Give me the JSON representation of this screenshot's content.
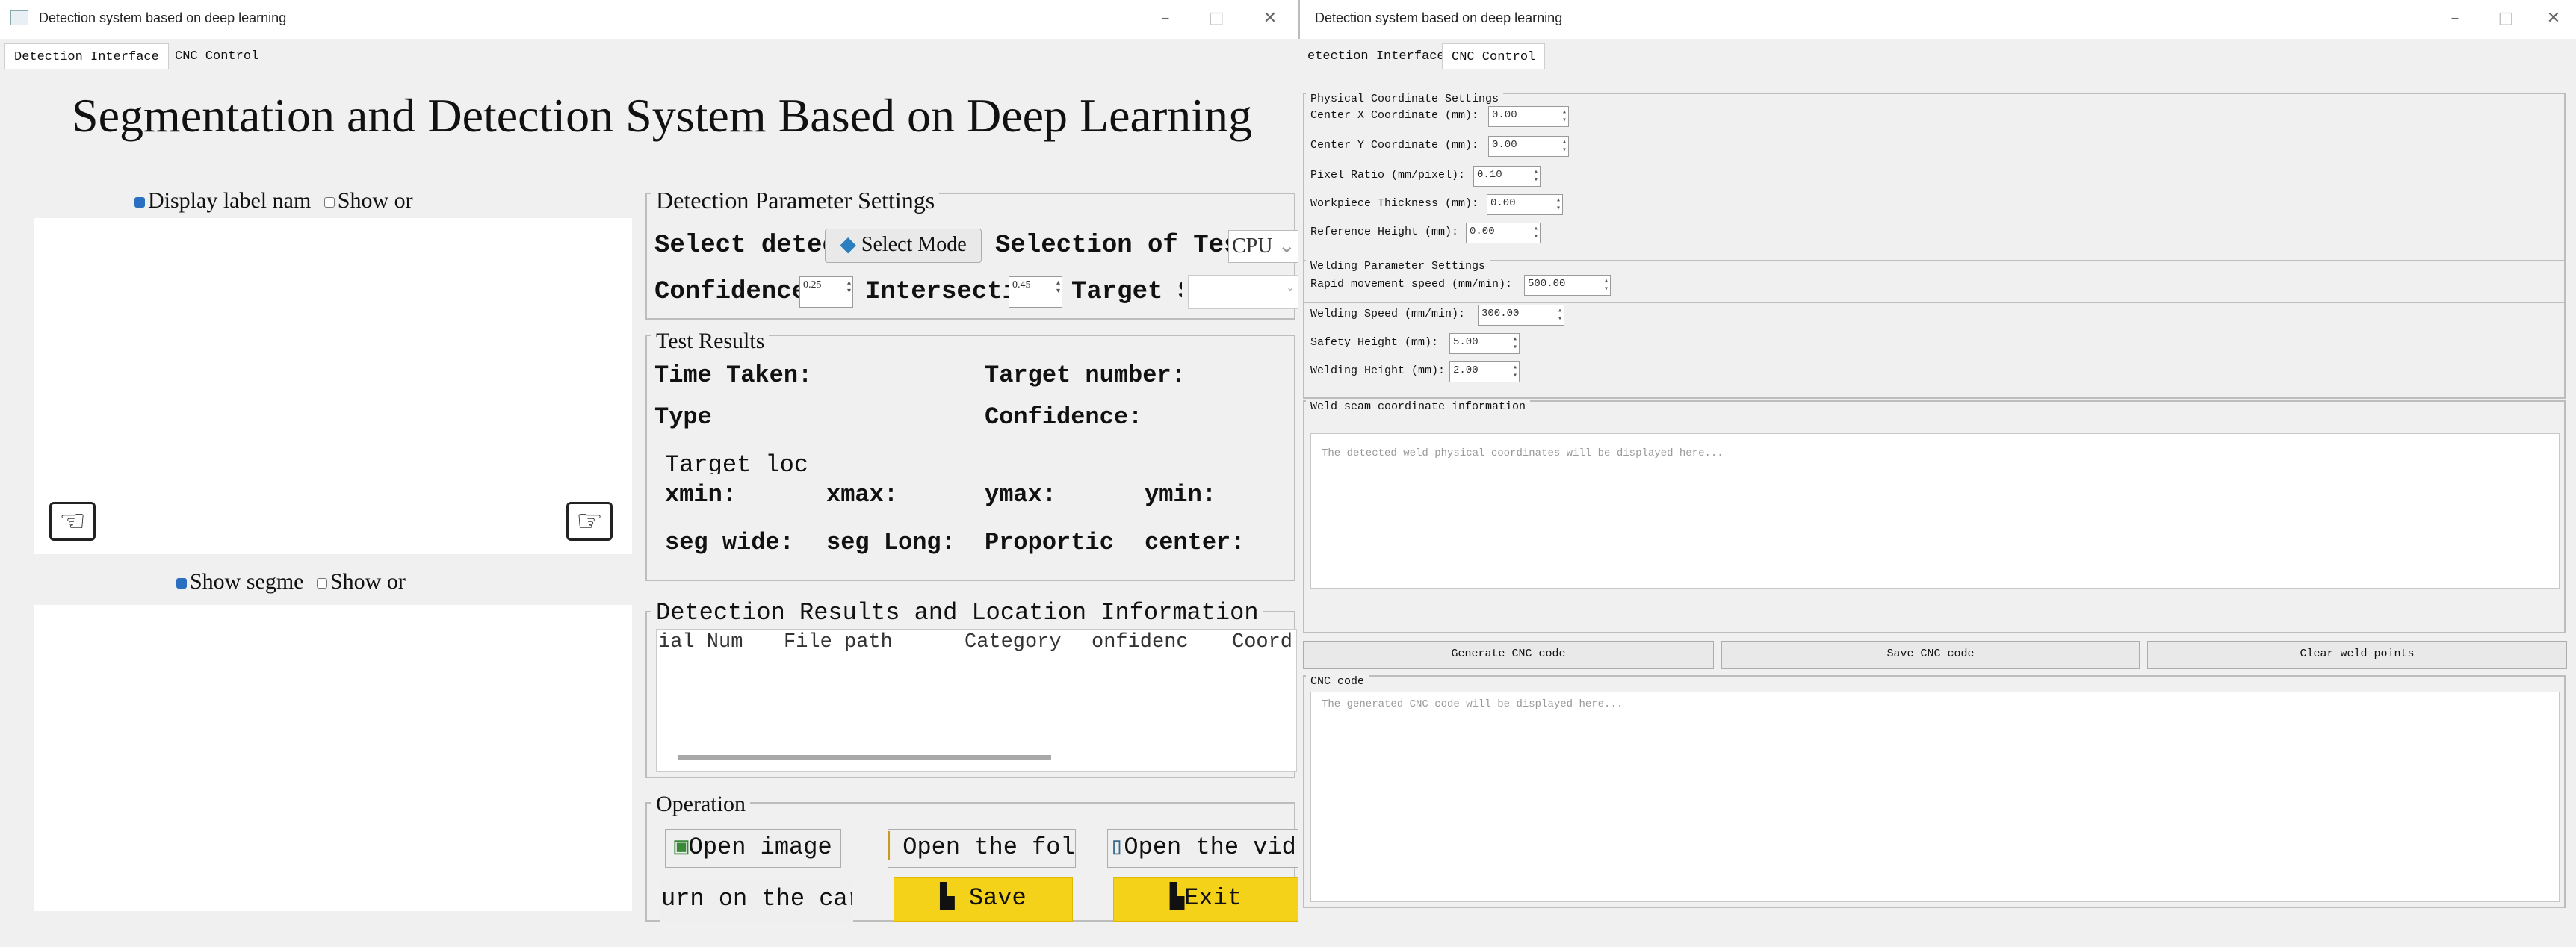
{
  "left_window": {
    "title": "Detection system based on deep learning",
    "tabs": [
      {
        "label": "Detection Interface",
        "active": true
      },
      {
        "label": "CNC Control",
        "active": false
      }
    ],
    "heading": "Segmentation and Detection System Based on Deep Learning",
    "top_view": {
      "radio_display_label": "Display label nam",
      "radio_show_or": "Show or",
      "prev_icon": "hand-left-icon",
      "next_icon": "hand-right-icon"
    },
    "bottom_view": {
      "radio_show_segment": "Show segme",
      "radio_show_or": "Show or"
    },
    "detection_params": {
      "title": "Detection Parameter Settings",
      "select_detector_label": "Select detec",
      "select_mode_button": "Select Mode",
      "selection_of_test_label": "Selection of Tes",
      "device_value": "CPU",
      "confidence_label": "Confidence",
      "confidence_value": "0.25",
      "intersection_label": "Intersecti",
      "intersection_value": "0.45",
      "target_label": "Target S",
      "target_value": ""
    },
    "test_results": {
      "title": "Test Results",
      "time_taken": "Time Taken:",
      "target_number": "Target number:",
      "type": "Type",
      "confidence": "Confidence:",
      "target_location": "Target loc",
      "xmin": "xmin:",
      "xmax": "xmax:",
      "ymax": "ymax:",
      "ymin": "ymin:",
      "seg_wide": "seg wide:",
      "seg_long": "seg Long:",
      "proportion": "Proportic",
      "center": "center:"
    },
    "results_table": {
      "title": "Detection Results and Location Information",
      "columns": [
        "ial Num",
        "File path",
        "Category",
        "onfidenc",
        "Coord"
      ]
    },
    "operation": {
      "title": "Operation",
      "open_image": "Open image",
      "open_folder": "Open the fold",
      "open_video": "Open the vid",
      "turn_on_camera": "urn on the car",
      "save": "Save",
      "exit": "Exit"
    }
  },
  "right_window": {
    "title": "Detection system based on deep learning",
    "tabs": [
      {
        "label": "etection Interface",
        "active": false
      },
      {
        "label": "CNC Control",
        "active": true
      }
    ],
    "physical_coords": {
      "title": "Physical Coordinate Settings",
      "fields": [
        {
          "label": "Center X Coordinate (mm):",
          "value": "0.00"
        },
        {
          "label": "Center Y Coordinate (mm):",
          "value": "0.00"
        },
        {
          "label": "Pixel Ratio (mm/pixel):",
          "value": "0.10"
        },
        {
          "label": "Workpiece Thickness (mm):",
          "value": "0.00"
        },
        {
          "label": "Reference Height (mm):",
          "value": "0.00"
        }
      ]
    },
    "welding_params": {
      "title": "Welding Parameter Settings",
      "fields": [
        {
          "label": "Rapid movement speed (mm/min):",
          "value": "500.00"
        },
        {
          "label": "Welding Speed (mm/min):",
          "value": "300.00"
        },
        {
          "label": "Safety Height (mm):",
          "value": "5.00"
        },
        {
          "label": "Welding Height (mm):",
          "value": "2.00"
        }
      ]
    },
    "weld_seam": {
      "title": "Weld seam coordinate information",
      "placeholder": "The detected weld physical coordinates will be displayed here..."
    },
    "buttons": {
      "generate": "Generate CNC code",
      "save": "Save CNC code",
      "clear": "Clear weld points"
    },
    "cnc_code": {
      "title": "CNC code",
      "placeholder": "The generated CNC code will be displayed here..."
    }
  },
  "window_controls": {
    "minimize": "–",
    "maximize": "□",
    "close": "✕"
  }
}
